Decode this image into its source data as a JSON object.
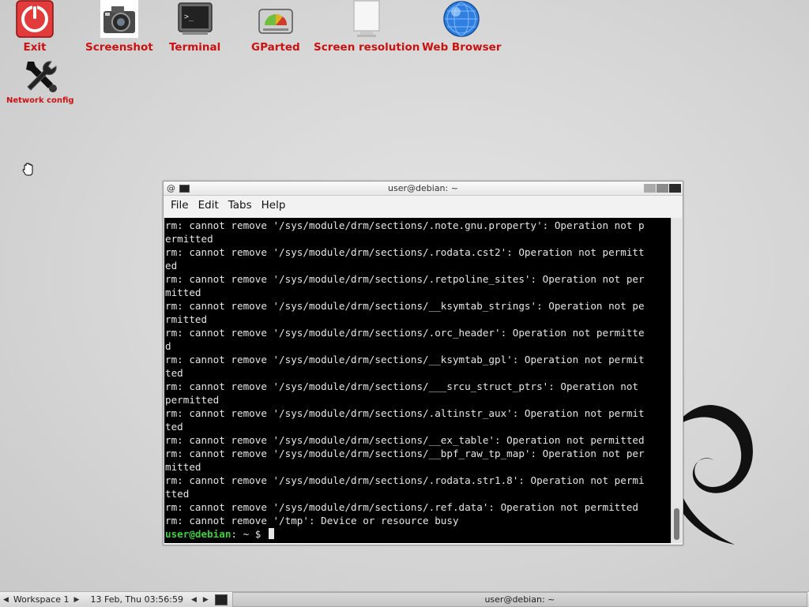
{
  "desktop": {
    "icons": [
      {
        "label": "Exit"
      },
      {
        "label": "Screenshot"
      },
      {
        "label": "Terminal"
      },
      {
        "label": "GParted"
      },
      {
        "label": "Screen resolution"
      },
      {
        "label": "Web Browser"
      },
      {
        "label": "Network config"
      }
    ]
  },
  "terminal": {
    "title": "user@debian: ~",
    "menu": [
      "File",
      "Edit",
      "Tabs",
      "Help"
    ],
    "lines": [
      "rm: cannot remove '/sys/module/drm/sections/.note.gnu.property': Operation not p",
      "ermitted",
      "rm: cannot remove '/sys/module/drm/sections/.rodata.cst2': Operation not permitt",
      "ed",
      "rm: cannot remove '/sys/module/drm/sections/.retpoline_sites': Operation not per",
      "mitted",
      "rm: cannot remove '/sys/module/drm/sections/__ksymtab_strings': Operation not pe",
      "rmitted",
      "rm: cannot remove '/sys/module/drm/sections/.orc_header': Operation not permitte",
      "d",
      "rm: cannot remove '/sys/module/drm/sections/__ksymtab_gpl': Operation not permit",
      "ted",
      "rm: cannot remove '/sys/module/drm/sections/___srcu_struct_ptrs': Operation not",
      "permitted",
      "rm: cannot remove '/sys/module/drm/sections/.altinstr_aux': Operation not permit",
      "ted",
      "rm: cannot remove '/sys/module/drm/sections/__ex_table': Operation not permitted",
      "rm: cannot remove '/sys/module/drm/sections/__bpf_raw_tp_map': Operation not per",
      "mitted",
      "rm: cannot remove '/sys/module/drm/sections/.rodata.str1.8': Operation not permi",
      "tted",
      "rm: cannot remove '/sys/module/drm/sections/.ref.data': Operation not permitted",
      "rm: cannot remove '/tmp': Device or resource busy"
    ],
    "prompt": {
      "user_host": "user@debian",
      "rest": ": ~ $ "
    }
  },
  "taskbar": {
    "workspace": "Workspace 1",
    "clock": "13 Feb, Thu 03:56:59",
    "task": "user@debian: ~"
  },
  "colors": {
    "icon_label": "#cc1111",
    "prompt_user": "#3cd13c",
    "terminal_bg": "#000000"
  }
}
